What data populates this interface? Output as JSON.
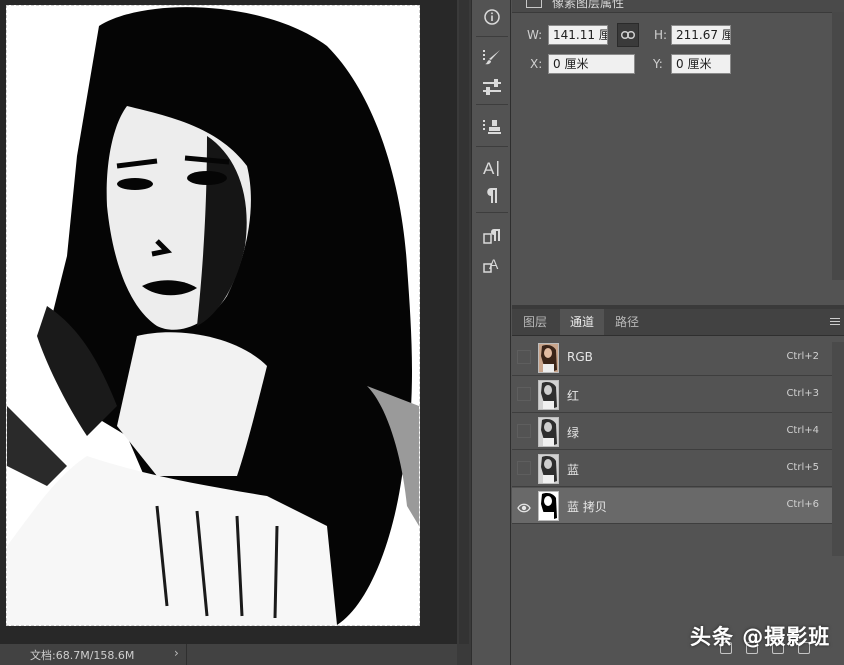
{
  "canvas": {
    "status_doc": "文档:68.7M/158.6M",
    "status_arrow": "›"
  },
  "toolstrip": {
    "tools": [
      "info-icon",
      "brush-presets-icon",
      "adjust-sliders-icon",
      "clone-source-icon",
      "character-icon",
      "paragraph-icon",
      "paragraph-style-icon",
      "character-style-icon"
    ]
  },
  "properties": {
    "title": "像素图层属性",
    "w_label": "W:",
    "w_value": "141.11 厘",
    "h_label": "H:",
    "h_value": "211.67 厘",
    "x_label": "X:",
    "x_value": "0 厘米",
    "y_label": "Y:",
    "y_value": "0 厘米"
  },
  "panel": {
    "tabs": [
      {
        "label": "图层",
        "active": false
      },
      {
        "label": "通道",
        "active": true
      },
      {
        "label": "路径",
        "active": false
      }
    ],
    "channels": [
      {
        "name": "RGB",
        "shortcut": "Ctrl+2",
        "visible": false,
        "selected": false,
        "thumb": "color"
      },
      {
        "name": "红",
        "shortcut": "Ctrl+3",
        "visible": false,
        "selected": false,
        "thumb": "gray"
      },
      {
        "name": "绿",
        "shortcut": "Ctrl+4",
        "visible": false,
        "selected": false,
        "thumb": "gray"
      },
      {
        "name": "蓝",
        "shortcut": "Ctrl+5",
        "visible": false,
        "selected": false,
        "thumb": "gray"
      },
      {
        "name": "蓝 拷贝",
        "shortcut": "Ctrl+6",
        "visible": true,
        "selected": true,
        "thumb": "bw"
      }
    ]
  },
  "watermark": "头条 @摄影班",
  "colors": {
    "panel_bg": "#535353",
    "canvas_bg": "#282828",
    "selected_row": "#696969",
    "field_bg": "#f0f0f0"
  }
}
